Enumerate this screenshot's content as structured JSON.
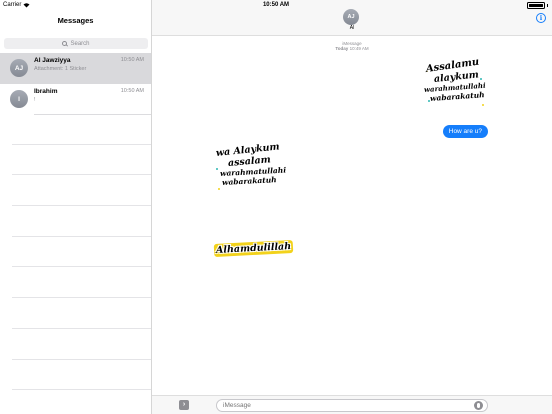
{
  "status_bar": {
    "carrier": "Carrier",
    "time": "10:50 AM",
    "battery_level": 1.0
  },
  "sidebar": {
    "title": "Messages",
    "search_placeholder": "Search",
    "conversations": [
      {
        "initials": "AJ",
        "name": "Al Jawziyya",
        "time": "10:50 AM",
        "preview": "Attachment: 1 Sticker",
        "selected": true
      },
      {
        "initials": "I",
        "name": "Ibrahim",
        "time": "10:50 AM",
        "preview": "!",
        "selected": false
      }
    ]
  },
  "conversation": {
    "contact_initials": "AJ",
    "contact_name": "Al",
    "service_label": "iMessage",
    "date_day": "Today",
    "date_time": "10:49 AM",
    "stickers": [
      {
        "lines": [
          "Assalamu",
          "alaykum",
          "warahmatullahi",
          "wabarakatuh"
        ]
      },
      {
        "lines": [
          "wa Alaykum",
          "assalam",
          "warahmatullahi",
          "wabarakatuh"
        ]
      },
      {
        "lines": [
          "Alhamdulillah"
        ]
      }
    ],
    "outgoing_message": "How are u?",
    "composer_placeholder": "iMessage"
  },
  "colors": {
    "accent": "#157efb",
    "selected_row": "#d9d9dc",
    "sticker_text": "#000000",
    "sticker_gold": "#f2d21b",
    "sticker_teal": "#2fb7b3"
  }
}
